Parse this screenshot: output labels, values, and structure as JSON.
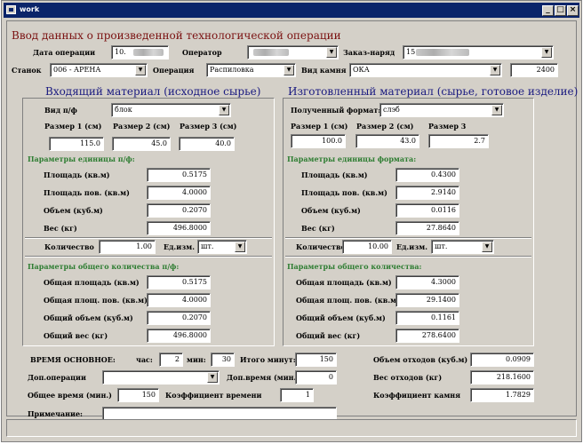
{
  "window": {
    "title": "work"
  },
  "form": {
    "title": "Ввод данных о произведенной технологической операции"
  },
  "top": {
    "date_label": "Дата операции",
    "date_value": "10.",
    "operator_label": "Оператор",
    "order_label": "Заказ-наряд",
    "order_value": "15",
    "machine_label": "Станок",
    "machine_value": "006 - АРЕНА",
    "operation_label": "Операция",
    "operation_value": "Распиловка",
    "stone_label": "Вид камня",
    "stone_value": "ОКА",
    "stone_code": "2400"
  },
  "left": {
    "title": "Входящий материал (исходное сырье)",
    "type_label": "Вид п/ф",
    "type_value": "блок",
    "size1_label": "Размер 1 (см)",
    "size2_label": "Размер 2 (см)",
    "size3_label": "Размер 3 (см)",
    "size1": "115.0",
    "size2": "45.0",
    "size3": "40.0",
    "unit_params": "Параметры единицы п/ф:",
    "area_label": "Площадь (кв.м)",
    "area": "0.5175",
    "area_red_label": "Площадь пов. (кв.м)",
    "area_red": "4.0000",
    "volume_label": "Объем (куб.м)",
    "volume": "0.2070",
    "weight_label": "Вес (кг)",
    "weight": "496.8000",
    "qty_label": "Количество",
    "qty": "1.00",
    "unit_label": "Ед.изм.",
    "unit": "шт.",
    "total_params": "Параметры общего количества п/ф:",
    "t_area_label": "Общая площадь (кв.м)",
    "t_area": "0.5175",
    "t_area_red_label": "Общая площ. пов. (кв.м)",
    "t_area_red": "4.0000",
    "t_volume_label": "Общий объем (куб.м)",
    "t_volume": "0.2070",
    "t_weight_label": "Общий вес (кг)",
    "t_weight": "496.8000"
  },
  "right": {
    "title": "Изготовленный материал (сырье, готовое изделие)",
    "type_label": "Полученный формат:",
    "type_value": "слэб",
    "size1_label": "Размер 1 (см)",
    "size2_label": "Размер 2 (см)",
    "size3_label": "Размер 3",
    "size1": "100.0",
    "size2": "43.0",
    "size3": "2.7",
    "unit_params": "Параметры единицы формата:",
    "area_label": "Площадь (кв.м)",
    "area": "0.4300",
    "area_red_label": "Площадь пов. (кв.м)",
    "area_red": "2.9140",
    "volume_label": "Объем (куб.м)",
    "volume": "0.0116",
    "weight_label": "Вес (кг)",
    "weight": "27.8640",
    "qty_label": "Количество",
    "qty": "10.00",
    "unit_label": "Ед.изм.",
    "unit": "шт.",
    "total_params": "Параметры общего количества:",
    "t_area_label": "Общая площадь (кв.м)",
    "t_area": "4.3000",
    "t_area_red_label": "Общая площ. пов. (кв.м)",
    "t_area_red": "29.1400",
    "t_volume_label": "Общий объем (куб.м)",
    "t_volume": "0.1161",
    "t_weight_label": "Общий вес (кг)",
    "t_weight": "278.6400"
  },
  "bottom": {
    "time_main_label": "ВРЕМЯ ОСНОВНОЕ:",
    "hours_label": "час:",
    "hours": "2",
    "min_label": "мин:",
    "minutes": "30",
    "total_min_label": "Итого минут:",
    "total_min": "150",
    "extra_ops_label": "Доп.операции",
    "extra_time_label": "Доп.время (мин.)",
    "extra_time": "0",
    "total_time_label": "Общее время (мин.)",
    "total_time": "150",
    "coef_time_label": "Коэффициент времени",
    "coef_time": "1",
    "note_label": "Примечание:",
    "waste_vol_label": "Объем отходов (куб.м)",
    "waste_vol": "0.0909",
    "waste_weight_label": "Вес отходов (кг)",
    "waste_weight": "218.1600",
    "coef_stone_label": "Коэффициент камня",
    "coef_stone": "1.7829"
  }
}
